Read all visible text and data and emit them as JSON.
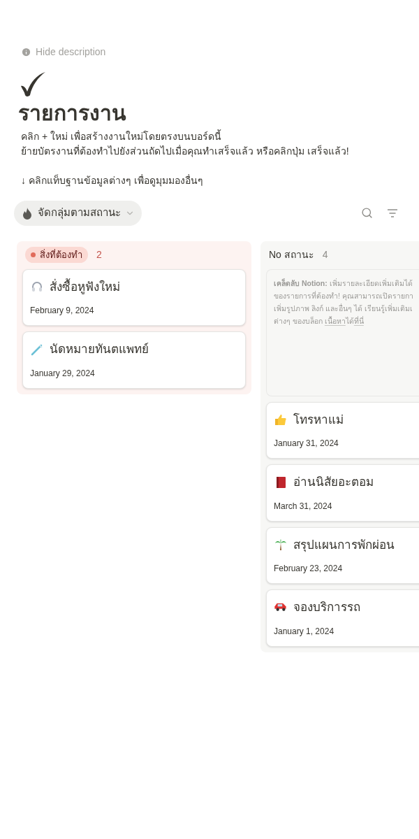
{
  "description_toggle": "Hide description",
  "title": "รายการงาน",
  "description": [
    "คลิก + ใหม่ เพื่อสร้างงานใหม่โดยตรงบนบอร์ดนี้",
    "ย้ายบัตรงานที่ต้องทำไปยังส่วนถัดไปเมื่อคุณทำเสร็จแล้ว หรือคลิกปุ่ม เสร็จแล้ว!",
    "↓ คลิกแท็บฐานข้อมูลต่างๆ เพื่อดูมุมมองอื่นๆ"
  ],
  "view_tab": {
    "label": "จัดกลุ่มตามสถานะ",
    "selected": true
  },
  "columns": [
    {
      "kind": "status",
      "label": "สิ่งที่ต้องทำ",
      "color": "#e16b5b",
      "count": "2",
      "cards": [
        {
          "kind": "headphones",
          "title": "สั่งซื้อหูฟังใหม่",
          "date": "February 9, 2024"
        },
        {
          "kind": "toothbrush",
          "title": "นัดหมายทันตแพทย์",
          "date": "January 29, 2024"
        }
      ]
    },
    {
      "kind": "plain",
      "label": "No สถานะ",
      "count": "4",
      "tip": {
        "lines": [
          "**เคล็ดลับ Notion:** เพิ่มรายละเอียดเพิ่มเติมได้",
          "ของรายการที่ต้องทำ! คุณสามารถเปิดรายกา",
          "เพิ่มรูปภาพ ลิงก์ และอื่นๆ ได้ เรียนรู้เพิ่มเติมเ"
        ],
        "last_line": [
          {
            "kind": "text",
            "text": "ต่างๆ ของบล็อก "
          },
          {
            "kind": "link",
            "text": "เนื้อหา"
          },
          {
            "kind": "text",
            "text": "ได้"
          },
          {
            "kind": "link",
            "text": "ที่นี่"
          }
        ]
      },
      "cards": [
        {
          "kind": "thumb",
          "title": "โทรหาแม่",
          "date": "January 31, 2024"
        },
        {
          "kind": "book",
          "title": "อ่านนิสัยอะตอม",
          "date": "March 31, 2024"
        },
        {
          "kind": "palm",
          "title": "สรุปแผนการพักผ่อน",
          "date": "February 23, 2024"
        },
        {
          "kind": "car",
          "title": "จองบริการรถ",
          "date": "January 1, 2024"
        }
      ]
    }
  ]
}
